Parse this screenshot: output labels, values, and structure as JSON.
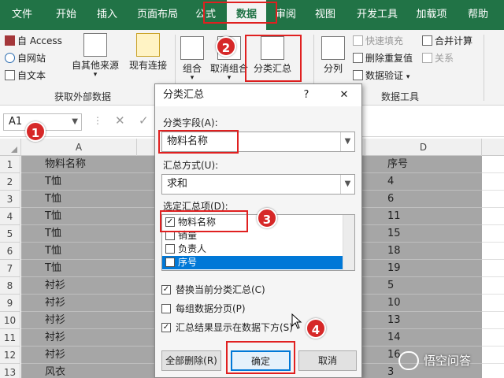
{
  "ribbon_tabs": [
    "文件",
    "开始",
    "插入",
    "页面布局",
    "公式",
    "数据",
    "审阅",
    "视图",
    "开发工具",
    "加载项",
    "帮助"
  ],
  "active_tab": "数据",
  "ribbon": {
    "ext_access": "自 Access",
    "ext_web": "自网站",
    "ext_text": "自文本",
    "ext_other": "自其他来源",
    "existing_conn": "现有连接",
    "ext_group_label": "获取外部数据",
    "group_btn": "组合",
    "ungroup_btn": "取消组合",
    "subtotal_btn": "分类汇总",
    "split_btn": "分列",
    "flash_fill": "快速填充",
    "remove_dup": "删除重复值",
    "validation": "数据验证",
    "consolidate": "合并计算",
    "relations": "关系",
    "data_tools_label": "数据工具"
  },
  "name_box": "A1",
  "columns": [
    "A",
    "D"
  ],
  "rows": [
    {
      "n": "1",
      "a": "物料名称",
      "d": "序号"
    },
    {
      "n": "2",
      "a": "T恤",
      "d": "4"
    },
    {
      "n": "3",
      "a": "T恤",
      "d": "6"
    },
    {
      "n": "4",
      "a": "T恤",
      "d": "11"
    },
    {
      "n": "5",
      "a": "T恤",
      "d": "15"
    },
    {
      "n": "6",
      "a": "T恤",
      "d": "18"
    },
    {
      "n": "7",
      "a": "T恤",
      "d": "19"
    },
    {
      "n": "8",
      "a": "衬衫",
      "d": "5"
    },
    {
      "n": "9",
      "a": "衬衫",
      "d": "10"
    },
    {
      "n": "10",
      "a": "衬衫",
      "d": "13"
    },
    {
      "n": "11",
      "a": "衬衫",
      "d": "14"
    },
    {
      "n": "12",
      "a": "衬衫",
      "d": "16"
    },
    {
      "n": "13",
      "a": "风衣",
      "d": "3"
    }
  ],
  "dialog": {
    "title": "分类汇总",
    "help": "?",
    "close": "✕",
    "field_label": "分类字段(A):",
    "field_value": "物料名称",
    "method_label": "汇总方式(U):",
    "method_value": "求和",
    "items_label": "选定汇总项(D):",
    "items": [
      {
        "label": "物料名称",
        "checked": true
      },
      {
        "label": "销量",
        "checked": false
      },
      {
        "label": "负责人",
        "checked": false
      },
      {
        "label": "序号",
        "checked": false,
        "selected": true
      }
    ],
    "opt_replace": "替换当前分类汇总(C)",
    "opt_pagebreak": "每组数据分页(P)",
    "opt_below": "汇总结果显示在数据下方(S)",
    "btn_remove_all": "全部删除(R)",
    "btn_ok": "确定",
    "btn_cancel": "取消"
  },
  "badges": [
    "1",
    "2",
    "3",
    "4"
  ],
  "watermark": "悟空问答",
  "colors": {
    "excel_green": "#217346",
    "highlight_red": "#e02020",
    "badge_red": "#d62828",
    "select_blue": "#0078d7"
  }
}
